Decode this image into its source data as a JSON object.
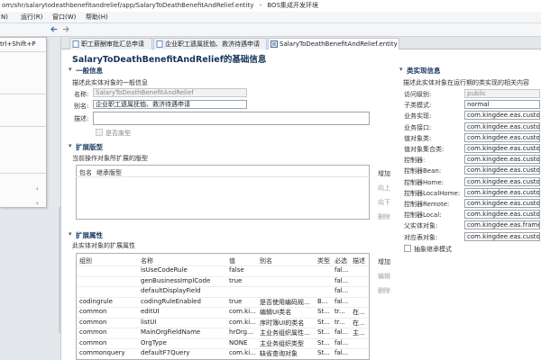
{
  "window": {
    "title_path": "om/shr/salarytodeathbenefitandrelief/app/SalaryToDeathBenefitAndRelief.entity",
    "app_title": "BOS集成开发环境"
  },
  "menu": [
    "N)",
    "运行(R)",
    "窗口(W)",
    "帮助(H)"
  ],
  "left_menu": {
    "shortcut": "trl+Shift+P"
  },
  "tabs": [
    {
      "label": "职工薪酬审批汇总申请",
      "active": false
    },
    {
      "label": "企业职工遗属抚恤、救济待遇申请",
      "active": false
    },
    {
      "label": "SalaryToDeathBenefitAndRelief.entity",
      "active": true
    }
  ],
  "editor": {
    "title": "SalaryToDeathBenefitAndRelief的基础信息",
    "general": {
      "header": "一般信息",
      "desc": "描述此实体对象的一般信息",
      "name_label": "名称:",
      "name_value": "SalaryToDeathBenefitAndRelief",
      "alias_label": "别名:",
      "alias_value": "企业职工遗属抚恤、救济待遇申请",
      "desc_label": "描述:",
      "desc_value": "",
      "deprecated_label": "是否废型"
    },
    "extension": {
      "header": "扩展版型",
      "desc": "当前操作对象所扩展的版型",
      "columns": [
        "包名",
        "继承版型"
      ],
      "buttons": [
        "增加",
        "向上",
        "向下",
        "删除"
      ]
    },
    "properties": {
      "header": "扩展属性",
      "desc": "此实体对象的扩展属性",
      "columns": [
        "组别",
        "名称",
        "值",
        "别名",
        "类型",
        "必选",
        "描述"
      ],
      "buttons": [
        "增加",
        "编辑",
        "删除"
      ],
      "rows": [
        {
          "group": "",
          "name": "isUseCodeRule",
          "value": "false",
          "alias": "",
          "type": "",
          "req": "fal...",
          "desc": ""
        },
        {
          "group": "",
          "name": "genBusinessImplCode",
          "value": "true",
          "alias": "",
          "type": "",
          "req": "fal...",
          "desc": ""
        },
        {
          "group": "",
          "name": "defaultDisplayField",
          "value": "",
          "alias": "",
          "type": "",
          "req": "fal...",
          "desc": ""
        },
        {
          "group": "codingrule",
          "name": "codingRuleEnabled",
          "value": "true",
          "alias": "是否使用编码规...",
          "type": "B...",
          "req": "fal...",
          "desc": ""
        },
        {
          "group": "common",
          "name": "editUI",
          "value": "com.ki...",
          "alias": "编辑UI类名",
          "type": "St...",
          "req": "tr...",
          "desc": "在..."
        },
        {
          "group": "common",
          "name": "listUI",
          "value": "com.ki...",
          "alias": "序时簿UI的类名",
          "type": "St...",
          "req": "tr...",
          "desc": "在..."
        },
        {
          "group": "common",
          "name": "MainOrgFieldName",
          "value": "hrOrg...",
          "alias": "主业务组织属性...",
          "type": "St...",
          "req": "fal...",
          "desc": "主..."
        },
        {
          "group": "common",
          "name": "OrgType",
          "value": "NONE",
          "alias": "主业务组织类型",
          "type": "St...",
          "req": "fal...",
          "desc": ""
        },
        {
          "group": "commonquery",
          "name": "defaultF7Query",
          "value": "com.ki...",
          "alias": "缺省查询对象",
          "type": "St...",
          "req": "fal...",
          "desc": ""
        }
      ]
    },
    "class_impl": {
      "header": "类实现信息",
      "desc": "描述此实体对象在运行期的类实现的相关内容",
      "fields": [
        {
          "label": "访问级别:",
          "value": "public",
          "disabled": true
        },
        {
          "label": "子类模式:",
          "value": "normal",
          "disabled": false
        },
        {
          "label": "业务实现:",
          "value": "com.kingdee.eas.custom",
          "disabled": false
        },
        {
          "label": "业务接口:",
          "value": "com.kingdee.eas.custom",
          "disabled": false
        },
        {
          "label": "值对象类:",
          "value": "com.kingdee.eas.custom",
          "disabled": false
        },
        {
          "label": "值对象集合类:",
          "value": "com.kingdee.eas.custom",
          "disabled": false
        },
        {
          "label": "控制器:",
          "value": "com.kingdee.eas.custom",
          "disabled": false
        },
        {
          "label": "控制器Bean:",
          "value": "com.kingdee.eas.custom",
          "disabled": false
        },
        {
          "label": "控制器Home:",
          "value": "com.kingdee.eas.custom",
          "disabled": false
        },
        {
          "label": "控制器LocalHome:",
          "value": "com.kingdee.eas.custom",
          "disabled": false
        },
        {
          "label": "控制器Remote:",
          "value": "com.kingdee.eas.custom",
          "disabled": false
        },
        {
          "label": "控制器Local:",
          "value": "com.kingdee.eas.custom",
          "disabled": false
        },
        {
          "label": "父实体对象:",
          "value": "com.kingdee.eas.framew",
          "disabled": false
        },
        {
          "label": "对应表对象:",
          "value": "com.kingdee.eas.custom",
          "disabled": false
        }
      ],
      "abstract_label": "抽象继承模式"
    }
  },
  "colors": {
    "accent": "#1c3d66",
    "title": "#16345a",
    "border": "#9aa3ad"
  }
}
